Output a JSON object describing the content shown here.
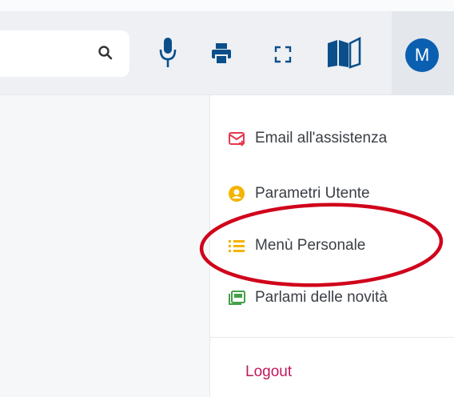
{
  "user": {
    "initial": "M",
    "avatar_color": "#0b5fb0"
  },
  "toolbar": {
    "search_icon": "search-icon",
    "icons": [
      "microphone-icon",
      "printer-icon",
      "fullscreen-icon",
      "book-icon"
    ]
  },
  "menu": {
    "items": [
      {
        "label": "Email all'assistenza",
        "icon": "mail-icon",
        "color": "#e53950"
      },
      {
        "label": "Parametri Utente",
        "icon": "user-circle-icon",
        "color": "#f4b400"
      },
      {
        "label": "Menù Personale",
        "icon": "list-icon",
        "color": "#f4b400"
      },
      {
        "label": "Parlami delle novità",
        "icon": "news-icon",
        "color": "#43a047"
      }
    ],
    "logout_label": "Logout",
    "logout_color": "#c2185b",
    "highlight_color": "#d0021b"
  }
}
